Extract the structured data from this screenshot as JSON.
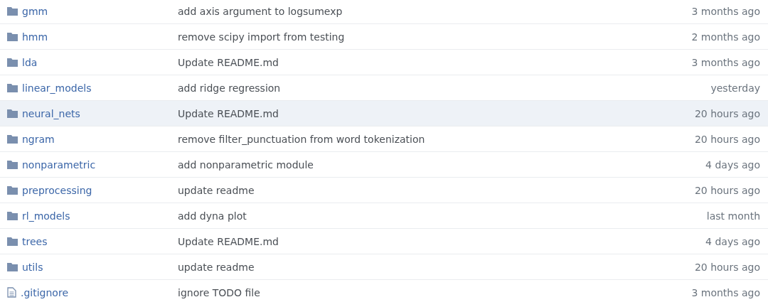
{
  "files": [
    {
      "kind": "folder",
      "name": "gmm",
      "message": "add axis argument to logsumexp",
      "age": "3 months ago",
      "highlighted": false
    },
    {
      "kind": "folder",
      "name": "hmm",
      "message": "remove scipy import from testing",
      "age": "2 months ago",
      "highlighted": false
    },
    {
      "kind": "folder",
      "name": "lda",
      "message": "Update README.md",
      "age": "3 months ago",
      "highlighted": false
    },
    {
      "kind": "folder",
      "name": "linear_models",
      "message": "add ridge regression",
      "age": "yesterday",
      "highlighted": false
    },
    {
      "kind": "folder",
      "name": "neural_nets",
      "message": "Update README.md",
      "age": "20 hours ago",
      "highlighted": true
    },
    {
      "kind": "folder",
      "name": "ngram",
      "message": "remove filter_punctuation from word tokenization",
      "age": "20 hours ago",
      "highlighted": false
    },
    {
      "kind": "folder",
      "name": "nonparametric",
      "message": "add nonparametric module",
      "age": "4 days ago",
      "highlighted": false
    },
    {
      "kind": "folder",
      "name": "preprocessing",
      "message": "update readme",
      "age": "20 hours ago",
      "highlighted": false
    },
    {
      "kind": "folder",
      "name": "rl_models",
      "message": "add dyna plot",
      "age": "last month",
      "highlighted": false
    },
    {
      "kind": "folder",
      "name": "trees",
      "message": "Update README.md",
      "age": "4 days ago",
      "highlighted": false
    },
    {
      "kind": "folder",
      "name": "utils",
      "message": "update readme",
      "age": "20 hours ago",
      "highlighted": false
    },
    {
      "kind": "file",
      "name": ".gitignore",
      "message": "ignore TODO file",
      "age": "3 months ago",
      "highlighted": false
    }
  ]
}
